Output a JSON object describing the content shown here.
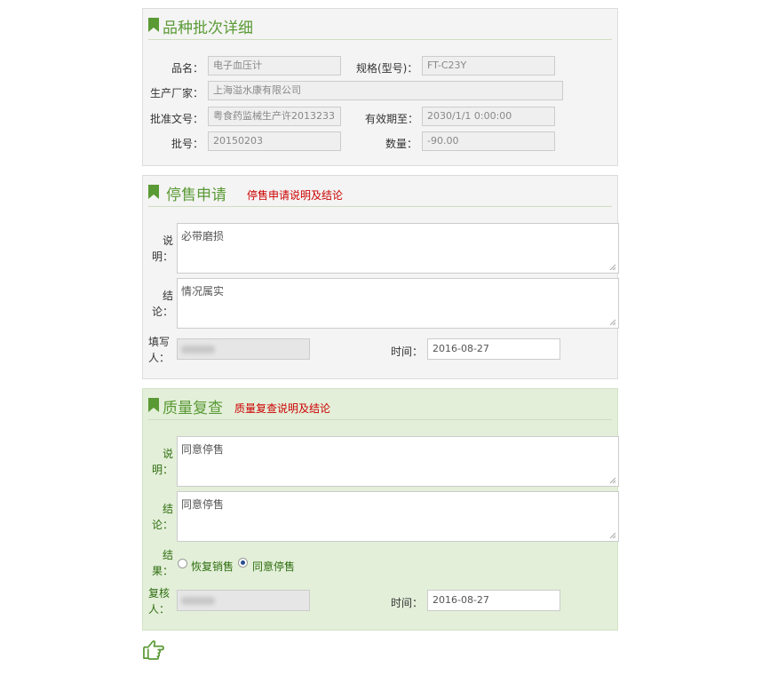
{
  "colors": {
    "accent": "#5a9a35",
    "alert": "#cc0000",
    "green_panel": "#e3efd9"
  },
  "batch": {
    "title": "品种批次详细",
    "name_label": "品名：",
    "name_value": "电子血压计",
    "spec_label": "规格(型号)：",
    "spec_value": "FT-C23Y",
    "maker_label": "生产厂家：",
    "maker_value": "上海溢水康有限公司",
    "approval_label": "批准文号：",
    "approval_value": "粤食药监械生产许2013233",
    "expiry_label": "有效期至：",
    "expiry_value": "2030/1/1 0:00:00",
    "lot_label": "批号：",
    "lot_value": "20150203",
    "qty_label": "数量：",
    "qty_value": "-90.00"
  },
  "stop_sale": {
    "title": "停售申请",
    "subtitle": "停售申请说明及结论",
    "desc_label_1": "说",
    "desc_label_2": "明：",
    "desc_value": "必带磨损",
    "concl_label_1": "结",
    "concl_label_2": "论：",
    "concl_value": "情况属实",
    "filler_label_1": "填写",
    "filler_label_2": "人：",
    "time_label": "时间：",
    "time_value": "2016-08-27"
  },
  "review": {
    "title": "质量复查",
    "subtitle": "质量复查说明及结论",
    "desc_label_1": "说",
    "desc_label_2": "明：",
    "desc_value": "同意停售",
    "concl_label_1": "结",
    "concl_label_2": "论：",
    "concl_value": "同意停售",
    "result_label_1": "结",
    "result_label_2": "果：",
    "option_resume": "恢复销售",
    "option_stop": "同意停售",
    "selected": "同意停售",
    "reviewer_label_1": "复核",
    "reviewer_label_2": "人：",
    "time_label": "时间：",
    "time_value": "2016-08-27"
  },
  "footer": {
    "icon": "pointing-hand-icon"
  }
}
